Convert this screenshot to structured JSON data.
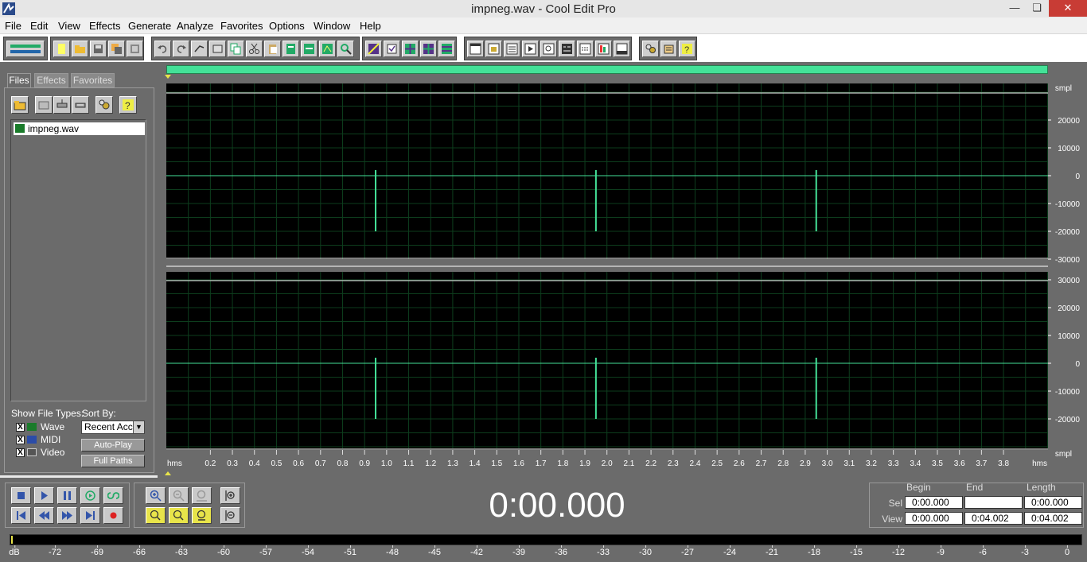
{
  "window": {
    "title": "impneg.wav - Cool Edit Pro",
    "min_glyph": "—",
    "max_glyph": "❏",
    "close_glyph": "✕"
  },
  "menu": [
    "File",
    "Edit",
    "View",
    "Effects",
    "Generate",
    "Analyze",
    "Favorites",
    "Options",
    "Window",
    "Help"
  ],
  "left_panel": {
    "tabs": [
      "Files",
      "Effects",
      "Favorites"
    ],
    "active_tab": "Files",
    "files": [
      "impneg.wav"
    ],
    "show_file_types_label": "Show File Types:",
    "sort_by_label": "Sort By:",
    "file_types": [
      {
        "label": "Wave",
        "checked": true
      },
      {
        "label": "MIDI",
        "checked": true
      },
      {
        "label": "Video",
        "checked": true
      }
    ],
    "sort_value": "Recent Acc",
    "check_glyph": "X",
    "dropdown_glyph": "▼",
    "auto_play": "Auto-Play",
    "full_paths": "Full Paths"
  },
  "waveform": {
    "colors": {
      "background": "#000000",
      "grid": "#0d3d1d",
      "wave": "#44e198",
      "axis_text": "#ffffff"
    },
    "amplitude_unit": "smpl",
    "time_unit": "hms",
    "channel1_ticks": [
      "20000",
      "10000",
      "0",
      "-10000",
      "-20000",
      "-30000"
    ],
    "channel2_ticks": [
      "30000",
      "20000",
      "10000",
      "0",
      "-10000",
      "-20000"
    ],
    "time_ticks": [
      "0.2",
      "0.3",
      "0.4",
      "0.5",
      "0.6",
      "0.7",
      "0.8",
      "0.9",
      "1.0",
      "1.1",
      "1.2",
      "1.3",
      "1.4",
      "1.5",
      "1.6",
      "1.7",
      "1.8",
      "1.9",
      "2.0",
      "2.1",
      "2.2",
      "2.3",
      "2.4",
      "2.5",
      "2.6",
      "2.7",
      "2.8",
      "2.9",
      "3.0",
      "3.1",
      "3.2",
      "3.3",
      "3.4",
      "3.5",
      "3.6",
      "3.7",
      "3.8"
    ],
    "impulse_times_s": [
      0.95,
      1.95,
      2.95
    ],
    "view_end_s": 4.002
  },
  "transport": {
    "time_display": "0:00.000"
  },
  "selection_info": {
    "headers": [
      "Begin",
      "End",
      "Length"
    ],
    "sel_label": "Sel",
    "view_label": "View",
    "sel": [
      "0:00.000",
      "",
      "0:00.000"
    ],
    "view": [
      "0:00.000",
      "0:04.002",
      "0:04.002"
    ]
  },
  "level_meter": {
    "unit": "dB",
    "ticks": [
      "-72",
      "-69",
      "-66",
      "-63",
      "-60",
      "-57",
      "-54",
      "-51",
      "-48",
      "-45",
      "-42",
      "-39",
      "-36",
      "-33",
      "-30",
      "-27",
      "-24",
      "-21",
      "-18",
      "-15",
      "-12",
      "-9",
      "-6",
      "-3",
      "0"
    ]
  }
}
